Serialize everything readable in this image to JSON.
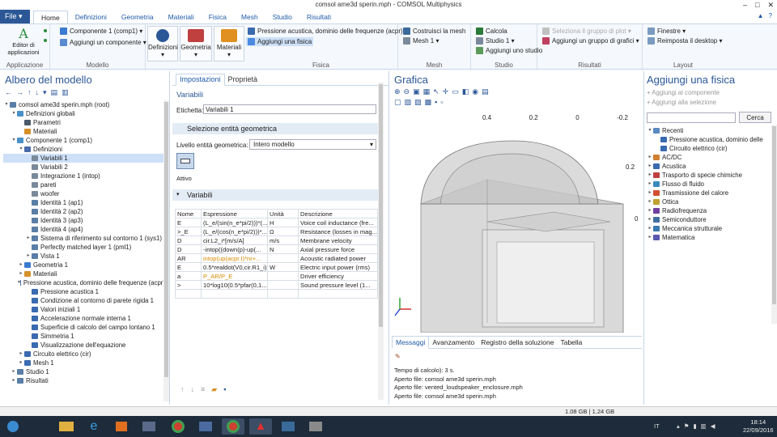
{
  "window": {
    "title": "comsol ame3d sperin.mph - COMSOL Multiphysics",
    "controls": [
      "–",
      "□",
      "✕"
    ]
  },
  "ribbon_tabs": {
    "file": "File ▾",
    "tabs": [
      "Home",
      "Definizioni",
      "Geometria",
      "Materiali",
      "Fisica",
      "Mesh",
      "Studio",
      "Risultati"
    ],
    "active": "Home"
  },
  "ribbon": {
    "applicazione": {
      "label": "Applicazione",
      "btn": "Editor di applicazioni"
    },
    "modello": {
      "label": "Modello",
      "componente": "Componente 1 (comp1) ▾",
      "aggiungi_componente": "Aggiungi un componente ▾"
    },
    "defs": {
      "definizioni": "Definizioni",
      "geometria": "Geometria",
      "materiali": "Materiali"
    },
    "fisica": {
      "label": "Fisica",
      "pressione": "Pressione acustica, dominio delle frequenze (acpr) ▾",
      "aggiungi_fisica": "Aggiungi una fisica"
    },
    "mesh": {
      "label": "Mesh",
      "costruisci": "Costruisci la mesh",
      "mesh1": "Mesh 1 ▾"
    },
    "studio": {
      "label": "Studio",
      "calcola": "Calcola",
      "studio1": "Studio 1 ▾",
      "aggiungi_studio": "Aggiungi uno studio"
    },
    "risultati": {
      "label": "Risultati",
      "seleziona": "Seleziona il gruppo di plot ▾",
      "aggiungi_grafici": "Aggiungi un gruppo di grafici ▾"
    },
    "layout": {
      "label": "Layout",
      "finestre": "Finestre ▾",
      "reimposta": "Reimposta il desktop ▾"
    }
  },
  "left": {
    "title": "Albero del modello",
    "tree": [
      {
        "d": 0,
        "t": "▾",
        "label": "comsol ame3d sperin.mph (root)",
        "c": "#5a7ea6"
      },
      {
        "d": 1,
        "t": "▾",
        "label": "Definizioni globali",
        "c": "#4a90c8"
      },
      {
        "d": 2,
        "t": "",
        "label": "Parametri",
        "c": "#4a5a6a"
      },
      {
        "d": 2,
        "t": "",
        "label": "Materiali",
        "c": "#d6902a"
      },
      {
        "d": 1,
        "t": "▾",
        "label": "Componente 1 (comp1)",
        "c": "#4a90c8"
      },
      {
        "d": 2,
        "t": "▾",
        "label": "Definizioni",
        "c": "#4a6aa8"
      },
      {
        "d": 3,
        "t": "",
        "label": "Variabili 1",
        "c": "#7a8a9a",
        "sel": true
      },
      {
        "d": 3,
        "t": "",
        "label": "Variabili 2",
        "c": "#7a8a9a"
      },
      {
        "d": 3,
        "t": "",
        "label": "Integrazione 1 (intop)",
        "c": "#7a8a9a"
      },
      {
        "d": 3,
        "t": "",
        "label": "pareti",
        "c": "#7a8a9a"
      },
      {
        "d": 3,
        "t": "",
        "label": "woofer",
        "c": "#7a8a9a"
      },
      {
        "d": 3,
        "t": "",
        "label": "Identità 1 (ap1)",
        "c": "#5a7ea6"
      },
      {
        "d": 3,
        "t": "",
        "label": "Identità 2 (ap2)",
        "c": "#5a7ea6"
      },
      {
        "d": 3,
        "t": "",
        "label": "Identità 3 (ap3)",
        "c": "#5a7ea6"
      },
      {
        "d": 3,
        "t": "",
        "label": "Identità 4 (ap4)",
        "c": "#5a7ea6"
      },
      {
        "d": 3,
        "t": "▸",
        "label": "Sistema di riferimento sul contorno 1 (sys1)",
        "c": "#5a7ea6"
      },
      {
        "d": 3,
        "t": "",
        "label": "Perfectly matched layer 1 (pml1)",
        "c": "#5a7ea6"
      },
      {
        "d": 3,
        "t": "▸",
        "label": "Vista 1",
        "c": "#5a7ea6"
      },
      {
        "d": 2,
        "t": "▸",
        "label": "Geometria 1",
        "c": "#3a7ad0"
      },
      {
        "d": 2,
        "t": "▸",
        "label": "Materiali",
        "c": "#d6902a"
      },
      {
        "d": 2,
        "t": "▾",
        "label": "Pressione acustica, dominio delle frequenze (acpr)",
        "c": "#3a6ab0"
      },
      {
        "d": 3,
        "t": "",
        "label": "Pressione acustica 1",
        "c": "#3a6ab0"
      },
      {
        "d": 3,
        "t": "",
        "label": "Condizione al contorno di parete rigida 1",
        "c": "#3a6ab0"
      },
      {
        "d": 3,
        "t": "",
        "label": "Valori iniziali 1",
        "c": "#3a6ab0"
      },
      {
        "d": 3,
        "t": "",
        "label": "Accelerazione normale interna 1",
        "c": "#3a6ab0"
      },
      {
        "d": 3,
        "t": "",
        "label": "Superficie di calcolo del campo lontano 1",
        "c": "#3a6ab0"
      },
      {
        "d": 3,
        "t": "",
        "label": "Simmetria 1",
        "c": "#3a6ab0"
      },
      {
        "d": 3,
        "t": "",
        "label": "Visualizzazione dell'equazione",
        "c": "#3a6ab0"
      },
      {
        "d": 2,
        "t": "▸",
        "label": "Circuito elettrico (cir)",
        "c": "#3a6ab0"
      },
      {
        "d": 2,
        "t": "▸",
        "label": "Mesh 1",
        "c": "#3a6ab0"
      },
      {
        "d": 1,
        "t": "▸",
        "label": "Studio 1",
        "c": "#5a7ea6"
      },
      {
        "d": 1,
        "t": "▸",
        "label": "Risultati",
        "c": "#5a7ea6"
      }
    ]
  },
  "middle": {
    "tabs": [
      "Impostazioni",
      "Proprietà"
    ],
    "heading": "Variabili",
    "etichetta_label": "Etichetta:",
    "etichetta_value": "Variabili 1",
    "selezione": "Selezione entità geometrica",
    "livello_label": "Livello entità geometrica:",
    "livello_value": "Intero modello",
    "attivo": "Attivo",
    "variabili": "Variabili",
    "headers": [
      "Nome",
      "Espressione",
      "Unità",
      "Descrizione"
    ],
    "rows": [
      [
        "E",
        "(L_e/(sin(n_e*pi/2)))*(...",
        "H",
        "Voice coil inductance (fre..."
      ],
      [
        ">_E",
        "(L_e/(cos(n_e*pi/2)))*...",
        "Ω",
        "Resistance (losses in mag..."
      ],
      [
        "D",
        "cir.L2_i*[m/s/A]",
        "m/s",
        "Membrane velocity"
      ],
      [
        "D",
        "-intop((down(p)-up(...",
        "N",
        "Axial pressure force"
      ],
      [
        "AR",
        "intop(up(acpr.I)*nr+...",
        "",
        "Acoustic radiated power"
      ],
      [
        "E",
        "0.5*realdot(V0,cir.R1_i)",
        "W",
        "Electric input power (rms)"
      ],
      [
        "a",
        "P_AR/P_E",
        "",
        "Driver efficiency"
      ],
      [
        ">",
        "10*log10(0.5*pfar(0,1...",
        "",
        "Sound pressure level (1..."
      ],
      [
        "",
        "",
        "",
        ""
      ]
    ]
  },
  "graphics": {
    "title": "Grafica",
    "axis_top": [
      "0.4",
      "0.2",
      "0",
      "-0.2"
    ],
    "axis_right": "0.2",
    "axis_right2": "0"
  },
  "messages": {
    "tabs": [
      "Messaggi",
      "Avanzamento",
      "Registro della soluzione",
      "Tabella"
    ],
    "lines": [
      "Tempo di calcolo): 3 s.",
      "Aperto file: comsol ame3d sperin.mph",
      "Aperto file: vented_loudspeaker_enclosure.mph",
      "Aperto file: comsol ame3d sperin.mph"
    ]
  },
  "right": {
    "title": "Aggiungi una fisica",
    "add_comp": "Aggiungi al componente",
    "add_sel": "Aggiungi alla selezione",
    "search_btn": "Cerca",
    "tree": [
      {
        "d": 0,
        "t": "▾",
        "label": "Recenti",
        "c": "#5a8ac0"
      },
      {
        "d": 1,
        "t": "",
        "label": "Pressione acustica, dominio delle",
        "c": "#3a6ab0"
      },
      {
        "d": 1,
        "t": "",
        "label": "Circuito elettrico (cir)",
        "c": "#3a6ab0"
      },
      {
        "d": 0,
        "t": "▸",
        "label": "AC/DC",
        "c": "#d08030"
      },
      {
        "d": 0,
        "t": "▸",
        "label": "Acustica",
        "c": "#3a6ab0"
      },
      {
        "d": 0,
        "t": "▸",
        "label": "Trasporto di specie chimiche",
        "c": "#c04040"
      },
      {
        "d": 0,
        "t": "▸",
        "label": "Flusso di fluido",
        "c": "#3a8ac0"
      },
      {
        "d": 0,
        "t": "▸",
        "label": "Trasmissione del calore",
        "c": "#d05030"
      },
      {
        "d": 0,
        "t": "▸",
        "label": "Ottica",
        "c": "#c0a030"
      },
      {
        "d": 0,
        "t": "▸",
        "label": "Radiofrequenza",
        "c": "#7040a0"
      },
      {
        "d": 0,
        "t": "▸",
        "label": "Semiconduttore",
        "c": "#4070a0"
      },
      {
        "d": 0,
        "t": "▸",
        "label": "Meccanica strutturale",
        "c": "#3a7ab0"
      },
      {
        "d": 0,
        "t": "▸",
        "label": "Matematica",
        "c": "#5a5ab0"
      }
    ]
  },
  "status": {
    "memory": "1.08 GB | 1.24 GB"
  },
  "taskbar": {
    "lang": "IT",
    "time": "18:14",
    "date": "22/09/2016"
  }
}
